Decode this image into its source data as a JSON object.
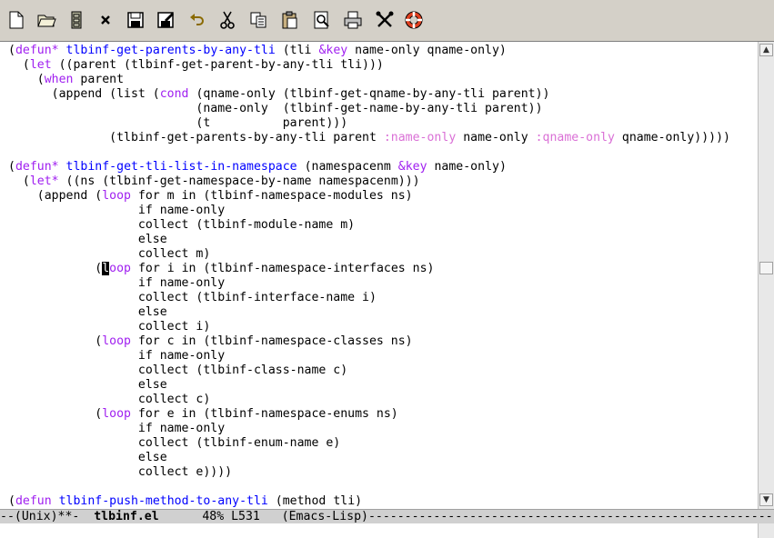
{
  "toolbar": {
    "buttons": [
      {
        "name": "new-file",
        "icon": "new-document-icon"
      },
      {
        "name": "open-folder",
        "icon": "folder-open-icon"
      },
      {
        "name": "dired",
        "icon": "file-cabinet-icon"
      },
      {
        "name": "close-buffer",
        "icon": "close-icon"
      },
      {
        "name": "save",
        "icon": "floppy-disk-icon"
      },
      {
        "name": "save-as",
        "icon": "floppy-pen-icon"
      },
      {
        "name": "undo",
        "icon": "undo-arrow-icon"
      },
      {
        "name": "cut",
        "icon": "scissors-icon"
      },
      {
        "name": "copy",
        "icon": "copy-icon"
      },
      {
        "name": "paste",
        "icon": "clipboard-icon"
      },
      {
        "name": "search",
        "icon": "magnifier-icon"
      },
      {
        "name": "print",
        "icon": "printer-icon"
      },
      {
        "name": "customize",
        "icon": "tools-icon"
      },
      {
        "name": "help",
        "icon": "lifebuoy-icon"
      }
    ]
  },
  "editor": {
    "lines": [
      [
        [
          "(",
          "n"
        ],
        [
          "defun*",
          "kw"
        ],
        [
          " ",
          "n"
        ],
        [
          "tlbinf-get-parents-by-any-tli",
          "fn"
        ],
        [
          " (tli ",
          "n"
        ],
        [
          "&key",
          "kw"
        ],
        [
          " name-only qname-only)",
          "n"
        ]
      ],
      [
        [
          "  (",
          "n"
        ],
        [
          "let",
          "kw"
        ],
        [
          " ((parent (tlbinf-get-parent-by-any-tli tli)))",
          "n"
        ]
      ],
      [
        [
          "    (",
          "n"
        ],
        [
          "when",
          "kw"
        ],
        [
          " parent",
          "n"
        ]
      ],
      [
        [
          "      (append (list (",
          "n"
        ],
        [
          "cond",
          "kw"
        ],
        [
          " (qname-only (tlbinf-get-qname-by-any-tli parent))",
          "n"
        ]
      ],
      [
        [
          "                          (name-only  (tlbinf-get-name-by-any-tli parent))",
          "n"
        ]
      ],
      [
        [
          "                          (t          parent)))",
          "n"
        ]
      ],
      [
        [
          "              (tlbinf-get-parents-by-any-tli parent ",
          "n"
        ],
        [
          ":name-only",
          "bi"
        ],
        [
          " name-only ",
          "n"
        ],
        [
          ":qname-only",
          "bi"
        ],
        [
          " qname-only)))))",
          "n"
        ]
      ],
      [
        [
          "",
          "n"
        ]
      ],
      [
        [
          "(",
          "n"
        ],
        [
          "defun*",
          "kw"
        ],
        [
          " ",
          "n"
        ],
        [
          "tlbinf-get-tli-list-in-namespace",
          "fn"
        ],
        [
          " (namespacenm ",
          "n"
        ],
        [
          "&key",
          "kw"
        ],
        [
          " name-only)",
          "n"
        ]
      ],
      [
        [
          "  (",
          "n"
        ],
        [
          "let*",
          "kw"
        ],
        [
          " ((ns (tlbinf-get-namespace-by-name namespacenm)))",
          "n"
        ]
      ],
      [
        [
          "    (append (",
          "n"
        ],
        [
          "loop",
          "kw"
        ],
        [
          " for m in (tlbinf-namespace-modules ns)",
          "n"
        ]
      ],
      [
        [
          "                  if name-only",
          "n"
        ]
      ],
      [
        [
          "                  collect (tlbinf-module-name m)",
          "n"
        ]
      ],
      [
        [
          "                  else",
          "n"
        ]
      ],
      [
        [
          "                  collect m)",
          "n"
        ]
      ],
      [
        [
          "            (",
          "n"
        ],
        [
          "l",
          "cur"
        ],
        [
          "oop",
          "kw"
        ],
        [
          " for i in (tlbinf-namespace-interfaces ns)",
          "n"
        ]
      ],
      [
        [
          "                  if name-only",
          "n"
        ]
      ],
      [
        [
          "                  collect (tlbinf-interface-name i)",
          "n"
        ]
      ],
      [
        [
          "                  else",
          "n"
        ]
      ],
      [
        [
          "                  collect i)",
          "n"
        ]
      ],
      [
        [
          "            (",
          "n"
        ],
        [
          "loop",
          "kw"
        ],
        [
          " for c in (tlbinf-namespace-classes ns)",
          "n"
        ]
      ],
      [
        [
          "                  if name-only",
          "n"
        ]
      ],
      [
        [
          "                  collect (tlbinf-class-name c)",
          "n"
        ]
      ],
      [
        [
          "                  else",
          "n"
        ]
      ],
      [
        [
          "                  collect c)",
          "n"
        ]
      ],
      [
        [
          "            (",
          "n"
        ],
        [
          "loop",
          "kw"
        ],
        [
          " for e in (tlbinf-namespace-enums ns)",
          "n"
        ]
      ],
      [
        [
          "                  if name-only",
          "n"
        ]
      ],
      [
        [
          "                  collect (tlbinf-enum-name e)",
          "n"
        ]
      ],
      [
        [
          "                  else",
          "n"
        ]
      ],
      [
        [
          "                  collect e))))",
          "n"
        ]
      ],
      [
        [
          "",
          "n"
        ]
      ],
      [
        [
          "(",
          "n"
        ],
        [
          "defun",
          "kw"
        ],
        [
          " ",
          "n"
        ],
        [
          "tlbinf-push-method-to-any-tli",
          "fn"
        ],
        [
          " (method tli)",
          "n"
        ]
      ]
    ]
  },
  "modeline": {
    "prefix": "--(Unix)**-  ",
    "buffer_name": "tlbinf.el",
    "position": "      48% L531   ",
    "mode": "(Emacs-Lisp)",
    "filler": "------------------------------------------------------------------"
  },
  "colors": {
    "keyword": "#a020f0",
    "function_name": "#0000ff",
    "builtin": "#da70d6",
    "toolbar_bg": "#d4d0c8",
    "modeline_bg": "#d0d0d0"
  }
}
